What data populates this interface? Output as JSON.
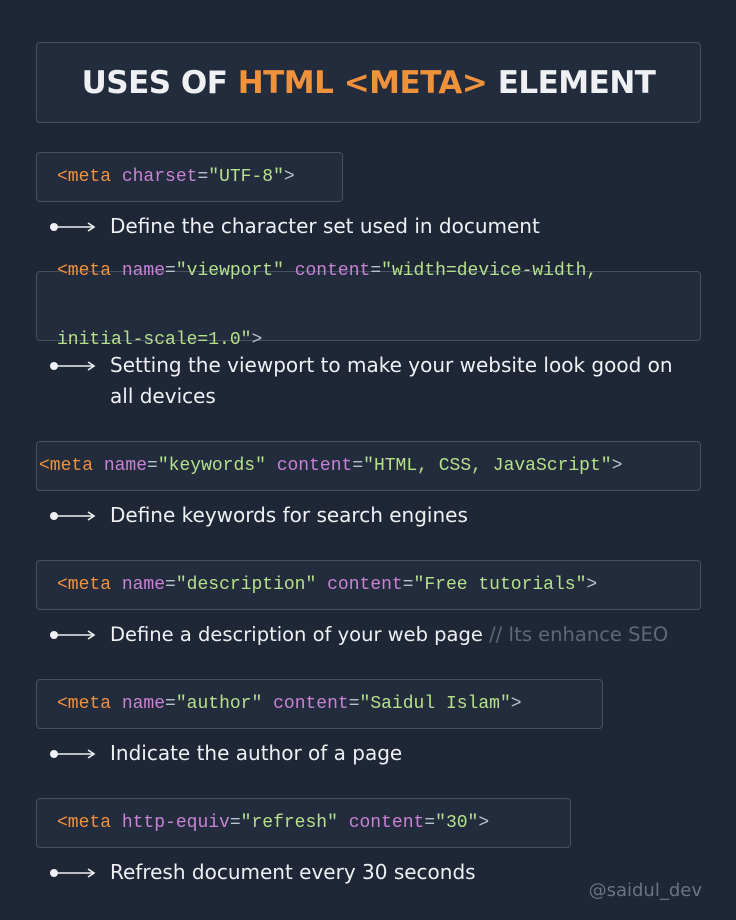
{
  "title": {
    "prefix": "USES OF ",
    "accent": "HTML <META>",
    "suffix": " ELEMENT"
  },
  "items": [
    {
      "code_line1": [
        {
          "t": "tag",
          "v": "<meta"
        },
        {
          "t": "sp",
          "v": " "
        },
        {
          "t": "attr",
          "v": "charset"
        },
        {
          "t": "eq",
          "v": "="
        },
        {
          "t": "str",
          "v": "\"UTF-8\""
        },
        {
          "t": "br",
          "v": ">"
        }
      ],
      "code_line2": [],
      "desc": "Define the character set used in document",
      "note": ""
    },
    {
      "code_line1": [
        {
          "t": "tag",
          "v": "<meta"
        },
        {
          "t": "sp",
          "v": " "
        },
        {
          "t": "attr",
          "v": "name"
        },
        {
          "t": "eq",
          "v": "="
        },
        {
          "t": "str",
          "v": "\"viewport\""
        },
        {
          "t": "sp",
          "v": " "
        },
        {
          "t": "attr",
          "v": "content"
        },
        {
          "t": "eq",
          "v": "="
        },
        {
          "t": "str",
          "v": "\"width=device-width,"
        }
      ],
      "code_line2": [
        {
          "t": "str",
          "v": "initial-scale=1.0\""
        },
        {
          "t": "br",
          "v": ">"
        }
      ],
      "desc": "Setting the viewport to make your website look good on all devices",
      "note": ""
    },
    {
      "code_line1": [
        {
          "t": "tag",
          "v": "<meta"
        },
        {
          "t": "sp",
          "v": " "
        },
        {
          "t": "attr",
          "v": "name"
        },
        {
          "t": "eq",
          "v": "="
        },
        {
          "t": "str",
          "v": "\"keywords\""
        },
        {
          "t": "sp",
          "v": " "
        },
        {
          "t": "attr",
          "v": "content"
        },
        {
          "t": "eq",
          "v": "="
        },
        {
          "t": "str",
          "v": "\"HTML, CSS, JavaScript\""
        },
        {
          "t": "br",
          "v": ">"
        }
      ],
      "code_line2": [],
      "desc": "Define keywords for search engines",
      "note": ""
    },
    {
      "code_line1": [
        {
          "t": "tag",
          "v": "<meta"
        },
        {
          "t": "sp",
          "v": " "
        },
        {
          "t": "attr",
          "v": "name"
        },
        {
          "t": "eq",
          "v": "="
        },
        {
          "t": "str",
          "v": "\"description\""
        },
        {
          "t": "sp",
          "v": " "
        },
        {
          "t": "attr",
          "v": "content"
        },
        {
          "t": "eq",
          "v": "="
        },
        {
          "t": "str",
          "v": "\"Free tutorials\""
        },
        {
          "t": "br",
          "v": ">"
        }
      ],
      "code_line2": [],
      "desc": "Define a description of your web page ",
      "note": "// Its enhance SEO"
    },
    {
      "code_line1": [
        {
          "t": "tag",
          "v": "<meta"
        },
        {
          "t": "sp",
          "v": " "
        },
        {
          "t": "attr",
          "v": "name"
        },
        {
          "t": "eq",
          "v": "="
        },
        {
          "t": "str",
          "v": "\"author\""
        },
        {
          "t": "sp",
          "v": " "
        },
        {
          "t": "attr",
          "v": "content"
        },
        {
          "t": "eq",
          "v": "="
        },
        {
          "t": "str",
          "v": "\"Saidul Islam\""
        },
        {
          "t": "br",
          "v": ">"
        }
      ],
      "code_line2": [],
      "desc": "Indicate the author of a page",
      "note": ""
    },
    {
      "code_line1": [
        {
          "t": "tag",
          "v": "<meta"
        },
        {
          "t": "sp",
          "v": " "
        },
        {
          "t": "attr",
          "v": "http-equiv"
        },
        {
          "t": "eq",
          "v": "="
        },
        {
          "t": "str",
          "v": "\"refresh\""
        },
        {
          "t": "sp",
          "v": " "
        },
        {
          "t": "attr",
          "v": "content"
        },
        {
          "t": "eq",
          "v": "="
        },
        {
          "t": "str",
          "v": "\"30\""
        },
        {
          "t": "br",
          "v": ">"
        }
      ],
      "code_line2": [],
      "desc": "Refresh document every 30 seconds",
      "note": ""
    }
  ],
  "handle": "@saidul_dev",
  "colors": {
    "background": "#1f2736",
    "box": "#232c3c",
    "border": "#455063",
    "accent": "#f0913b",
    "tag": "#f0913b",
    "attr": "#c882d4",
    "string": "#b5e08c"
  },
  "icons": {
    "bullet": "arrow-right-icon"
  }
}
